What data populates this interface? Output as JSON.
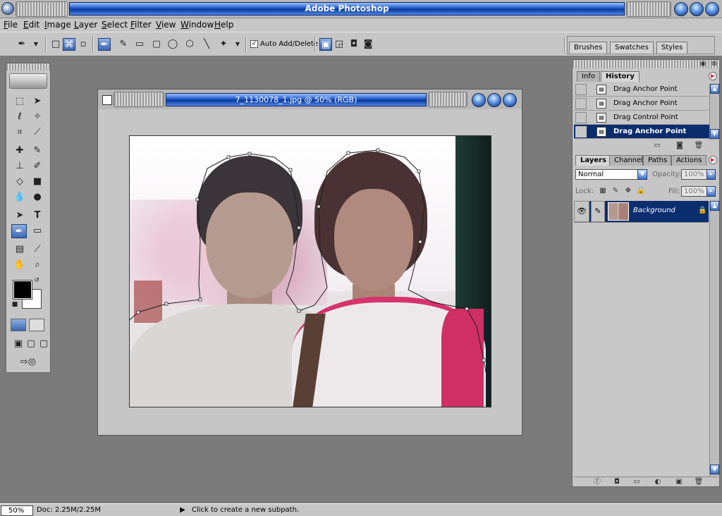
{
  "app": {
    "title": "Adobe Photoshop"
  },
  "menu": {
    "items": [
      {
        "first": "F",
        "rest": "ile"
      },
      {
        "first": "E",
        "rest": "dit"
      },
      {
        "first": "I",
        "rest": "mage"
      },
      {
        "first": "L",
        "rest": "ayer"
      },
      {
        "first": "S",
        "rest": "elect"
      },
      {
        "first": "F",
        "rest": "ilter"
      },
      {
        "first": "V",
        "rest": "iew"
      },
      {
        "first": "W",
        "rest": "indow"
      },
      {
        "first": "H",
        "rest": "elp"
      }
    ]
  },
  "options": {
    "auto_add_delete_label": "Auto Add/Delete",
    "auto_add_delete_checked": "✓"
  },
  "palette_well": {
    "tabs": [
      "Brushes",
      "Swatches",
      "Styles"
    ]
  },
  "document": {
    "title": "7_1130078_1.jpg @ 50% (RGB)"
  },
  "history_panel": {
    "tabs": [
      "Info",
      "History"
    ],
    "rows": [
      {
        "label": "Drag Anchor Point"
      },
      {
        "label": "Drag Anchor Point"
      },
      {
        "label": "Drag Control Point"
      },
      {
        "label": "Drag Anchor Point"
      }
    ]
  },
  "layers_panel": {
    "tabs": [
      "Layers",
      "Channels",
      "Paths",
      "Actions"
    ],
    "blend_mode": "Normal",
    "opacity_label": "Opacity:",
    "opacity_value": "100%",
    "lock_label": "Lock:",
    "fill_label": "Fill:",
    "fill_value": "100%",
    "layer_name": "Background"
  },
  "status": {
    "zoom": "50%",
    "doc_info": "Doc: 2.25M/2.25M",
    "hint": "Click to create a new subpath."
  },
  "colors": {
    "foreground": "#000000",
    "background": "#ffffff",
    "selection": "#0a2d6e"
  }
}
